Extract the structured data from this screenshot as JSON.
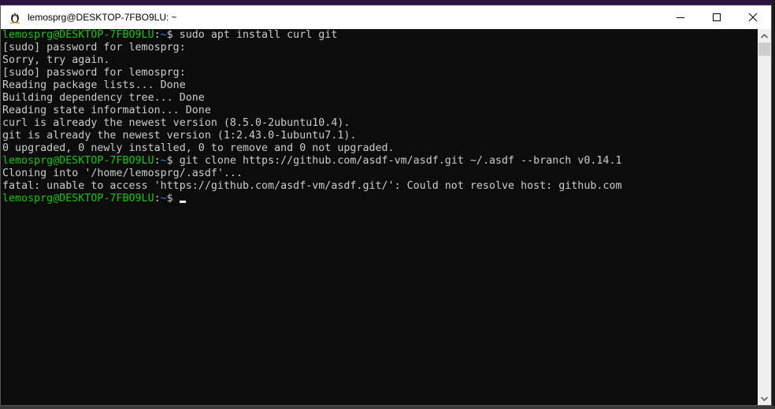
{
  "window": {
    "title": "lemosprg@DESKTOP-7FBO9LU: ~",
    "icon": "tux-linux-icon",
    "controls": [
      "minimize",
      "maximize",
      "close"
    ]
  },
  "terminal": {
    "user_host": "lemosprg@DESKTOP-7FBO9LU",
    "path": "~",
    "prompt_symbol": "$",
    "colors": {
      "background": "#0c0c0c",
      "text": "#cccccc",
      "user": "#16c60c",
      "path": "#3b78ff"
    },
    "lines": [
      {
        "type": "prompt",
        "command": " sudo apt install curl git"
      },
      {
        "type": "output",
        "text": "[sudo] password for lemosprg:"
      },
      {
        "type": "output",
        "text": "Sorry, try again."
      },
      {
        "type": "output",
        "text": "[sudo] password for lemosprg:"
      },
      {
        "type": "output",
        "text": "Reading package lists... Done"
      },
      {
        "type": "output",
        "text": "Building dependency tree... Done"
      },
      {
        "type": "output",
        "text": "Reading state information... Done"
      },
      {
        "type": "output",
        "text": "curl is already the newest version (8.5.0-2ubuntu10.4)."
      },
      {
        "type": "output",
        "text": "git is already the newest version (1:2.43.0-1ubuntu7.1)."
      },
      {
        "type": "output",
        "text": "0 upgraded, 0 newly installed, 0 to remove and 0 not upgraded."
      },
      {
        "type": "prompt",
        "command": " git clone https://github.com/asdf-vm/asdf.git ~/.asdf --branch v0.14.1"
      },
      {
        "type": "output",
        "text": "Cloning into '/home/lemosprg/.asdf'..."
      },
      {
        "type": "output",
        "text": "fatal: unable to access 'https://github.com/asdf-vm/asdf.git/': Could not resolve host: github.com"
      },
      {
        "type": "prompt",
        "command": "",
        "cursor": true
      }
    ]
  }
}
